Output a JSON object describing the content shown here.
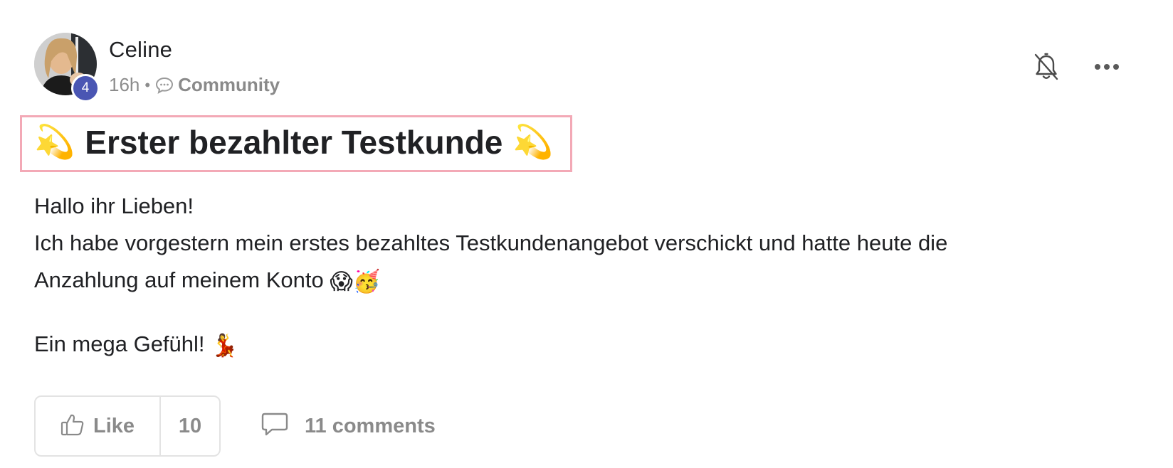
{
  "author": {
    "name": "Celine",
    "level": "4",
    "avatar_icon": "user-photo-avatar"
  },
  "meta": {
    "time": "16h",
    "separator": "•",
    "channel_icon": "speech-bubble-icon",
    "channel": "Community"
  },
  "actions": {
    "bell_icon": "bell-off-icon",
    "more_icon": "more-horizontal-icon"
  },
  "post": {
    "title_emoji": "💫",
    "title": "Erster bezahlter Testkunde",
    "body": {
      "line1": "Hallo ihr Lieben!",
      "line2": "Ich habe vorgestern mein erstes bezahltes Testkundenangebot verschickt und hatte heute die",
      "line3": "Anzahlung auf meinem Konto",
      "line3_emojis": "😱🥳",
      "line4": "Ein mega Gefühl!",
      "line4_emoji": "💃"
    }
  },
  "footer": {
    "like_label": "Like",
    "like_count": "10",
    "comments_label": "11 comments"
  },
  "colors": {
    "badge": "#4a56b3",
    "title_highlight_border": "#f3a9b6",
    "muted_text": "#8a8a8a",
    "text": "#202124"
  }
}
